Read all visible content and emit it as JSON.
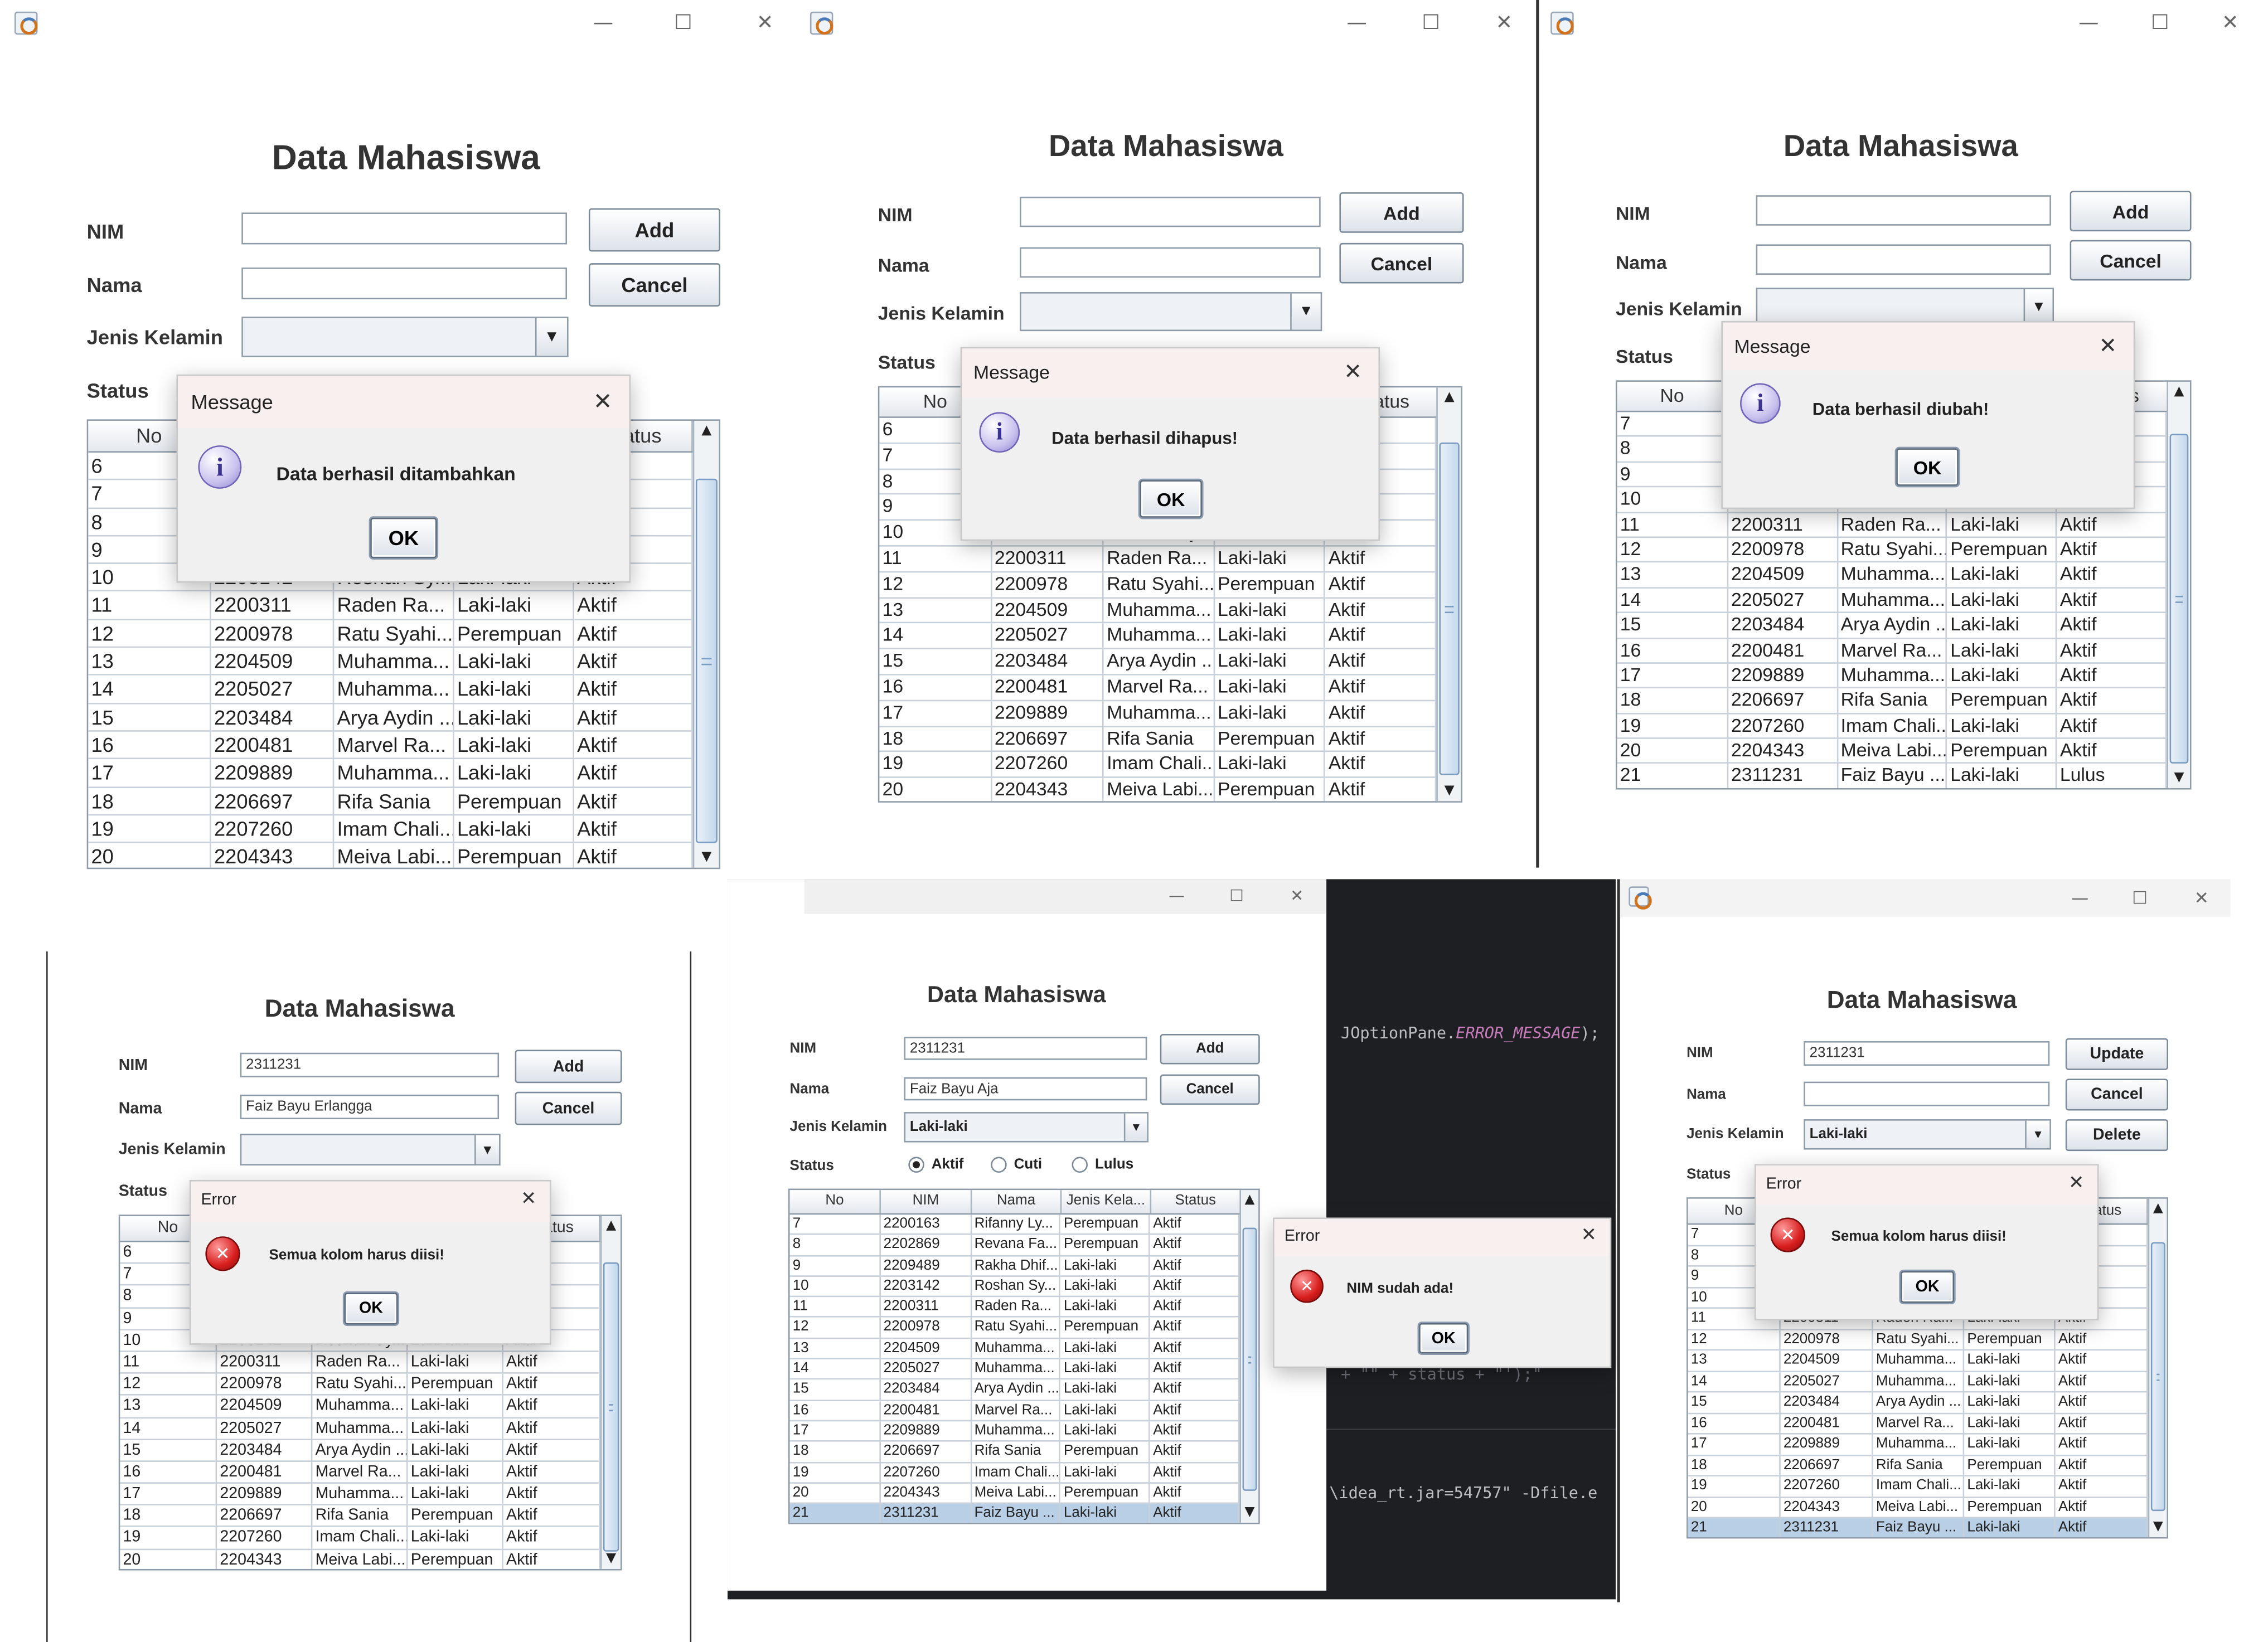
{
  "window": {
    "minimize": "—",
    "maximize": "☐",
    "close": "✕"
  },
  "app": {
    "title": "Data Mahasiswa",
    "labels": {
      "nim": "NIM",
      "nama": "Nama",
      "jenis_kelamin": "Jenis Kelamin",
      "status": "Status"
    },
    "buttons": {
      "add": "Add",
      "cancel": "Cancel",
      "update": "Update",
      "delete": "Delete"
    },
    "radio_options": [
      "Aktif",
      "Cuti",
      "Lulus"
    ],
    "columns": [
      "No",
      "NIM",
      "Nama",
      "Jenis Kela...",
      "Status"
    ]
  },
  "students": [
    {
      "no": "6",
      "nim": "",
      "nama": "",
      "jk": "",
      "status": ""
    },
    {
      "no": "7",
      "nim": "2200163",
      "nama": "Rifanny Ly...",
      "jk": "Perempuan",
      "status": "Aktif"
    },
    {
      "no": "8",
      "nim": "2202869",
      "nama": "Revana Fa...",
      "jk": "Perempuan",
      "status": "Aktif"
    },
    {
      "no": "9",
      "nim": "2209489",
      "nama": "Rakha Dhif...",
      "jk": "Laki-laki",
      "status": "Aktif"
    },
    {
      "no": "10",
      "nim": "2203142",
      "nama": "Roshan Sy...",
      "jk": "Laki-laki",
      "status": "Aktif"
    },
    {
      "no": "11",
      "nim": "2200311",
      "nama": "Raden Ra...",
      "jk": "Laki-laki",
      "status": "Aktif"
    },
    {
      "no": "12",
      "nim": "2200978",
      "nama": "Ratu Syahi...",
      "jk": "Perempuan",
      "status": "Aktif"
    },
    {
      "no": "13",
      "nim": "2204509",
      "nama": "Muhamma...",
      "jk": "Laki-laki",
      "status": "Aktif"
    },
    {
      "no": "14",
      "nim": "2205027",
      "nama": "Muhamma...",
      "jk": "Laki-laki",
      "status": "Aktif"
    },
    {
      "no": "15",
      "nim": "2203484",
      "nama": "Arya Aydin ...",
      "jk": "Laki-laki",
      "status": "Aktif"
    },
    {
      "no": "16",
      "nim": "2200481",
      "nama": "Marvel Ra...",
      "jk": "Laki-laki",
      "status": "Aktif"
    },
    {
      "no": "17",
      "nim": "2209889",
      "nama": "Muhamma...",
      "jk": "Laki-laki",
      "status": "Aktif"
    },
    {
      "no": "18",
      "nim": "2206697",
      "nama": "Rifa Sania",
      "jk": "Perempuan",
      "status": "Aktif"
    },
    {
      "no": "19",
      "nim": "2207260",
      "nama": "Imam Chali...",
      "jk": "Laki-laki",
      "status": "Aktif"
    },
    {
      "no": "20",
      "nim": "2204343",
      "nama": "Meiva Labi...",
      "jk": "Perempuan",
      "status": "Aktif"
    }
  ],
  "student21": {
    "lulus": {
      "no": "21",
      "nim": "2311231",
      "nama": "Faiz Bayu ...",
      "jk": "Laki-laki",
      "status": "Lulus"
    },
    "aktif": {
      "no": "21",
      "nim": "2311231",
      "nama": "Faiz Bayu ...",
      "jk": "Laki-laki",
      "status": "Aktif"
    }
  },
  "forms": {
    "p4": {
      "nim": "2311231",
      "nama": "Faiz Bayu Erlangga"
    },
    "p5": {
      "nim": "2311231",
      "nama": "Faiz Bayu Aja",
      "jk": "Laki-laki"
    },
    "p6": {
      "nim": "2311231",
      "nama": "",
      "jk": "Laki-laki"
    }
  },
  "dialogs": {
    "added": {
      "title": "Message",
      "message": "Data berhasil ditambahkan",
      "ok": "OK",
      "icon": "info-icon"
    },
    "deleted": {
      "title": "Message",
      "message": "Data berhasil dihapus!",
      "ok": "OK",
      "icon": "info-icon"
    },
    "updated": {
      "title": "Message",
      "message": "Data berhasil diubah!",
      "ok": "OK",
      "icon": "info-icon"
    },
    "empty_fields": {
      "title": "Error",
      "message": "Semua kolom harus diisi!",
      "ok": "OK",
      "icon": "error-icon"
    },
    "nim_exists": {
      "title": "Error",
      "message": "NIM sudah ada!",
      "ok": "OK",
      "icon": "error-icon"
    }
  },
  "ide": {
    "code_line_1": "JOptionPane.",
    "code_constant": "ERROR_MESSAGE",
    "code_line_1_end": ");",
    "code_line_2": "+ \"\" + status + \"');\"",
    "code_line_3": "\\idea_rt.jar=54757\" -Dfile.e"
  }
}
